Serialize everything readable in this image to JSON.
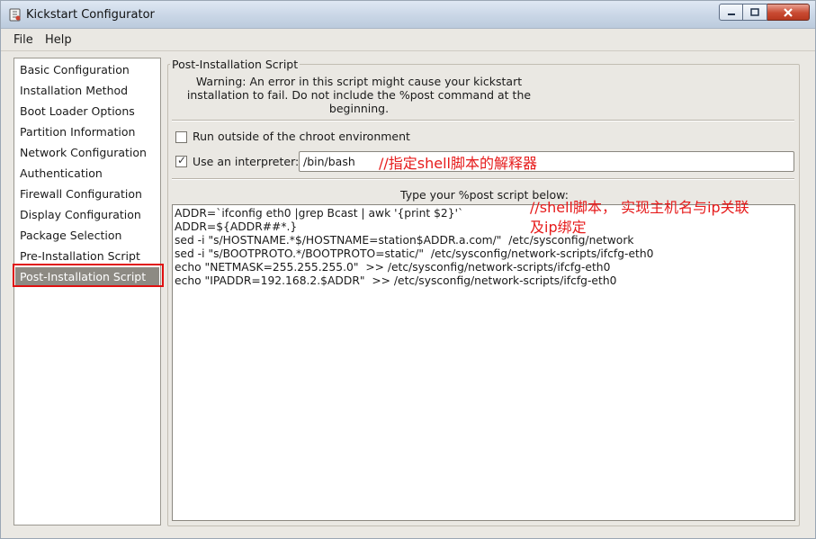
{
  "window": {
    "title": "Kickstart Configurator",
    "icon": "kickstart-app-icon",
    "controls": {
      "minimize": "minimize-icon",
      "maximize": "maximize-icon",
      "close": "close-icon"
    }
  },
  "menu": {
    "file": "File",
    "help": "Help"
  },
  "sidebar": {
    "items": [
      {
        "label": "Basic Configuration"
      },
      {
        "label": "Installation Method"
      },
      {
        "label": "Boot Loader Options"
      },
      {
        "label": "Partition Information"
      },
      {
        "label": "Network Configuration"
      },
      {
        "label": "Authentication"
      },
      {
        "label": "Firewall Configuration"
      },
      {
        "label": "Display Configuration"
      },
      {
        "label": "Package Selection"
      },
      {
        "label": "Pre-Installation Script"
      },
      {
        "label": "Post-Installation Script",
        "selected": true
      }
    ]
  },
  "panel": {
    "title": "Post-Installation Script",
    "warning": "Warning: An error in this script might cause your kickstart installation to fail. Do not include the %post command at the beginning.",
    "chroot_label": "Run outside of the chroot environment",
    "chroot_checked": false,
    "interpreter_label": "Use an interpreter:",
    "interpreter_checked": true,
    "interpreter_value": "/bin/bash",
    "type_label": "Type your %post script below:",
    "script_lines": [
      "ADDR=`ifconfig eth0 |grep Bcast | awk '{print $2}'`",
      "ADDR=${ADDR##*.}",
      "sed -i \"s/HOSTNAME.*$/HOSTNAME=station$ADDR.a.com/\"  /etc/sysconfig/network",
      "sed -i \"s/BOOTPROTO.*/BOOTPROTO=static/\"  /etc/sysconfig/network-scripts/ifcfg-eth0",
      "echo \"NETMASK=255.255.255.0\"  >> /etc/sysconfig/network-scripts/ifcfg-eth0",
      "echo \"IPADDR=192.168.2.$ADDR\"  >> /etc/sysconfig/network-scripts/ifcfg-eth0"
    ]
  },
  "annotations": {
    "interpreter_note": "//指定shell脚本的解释器",
    "script_note_line1": "//shell脚本， 实现主机名与ip关联",
    "script_note_line2": "及ip绑定",
    "color": "#e61b1b"
  },
  "colors": {
    "selection": "#8d8a83",
    "highlight_box": "#e01010"
  }
}
